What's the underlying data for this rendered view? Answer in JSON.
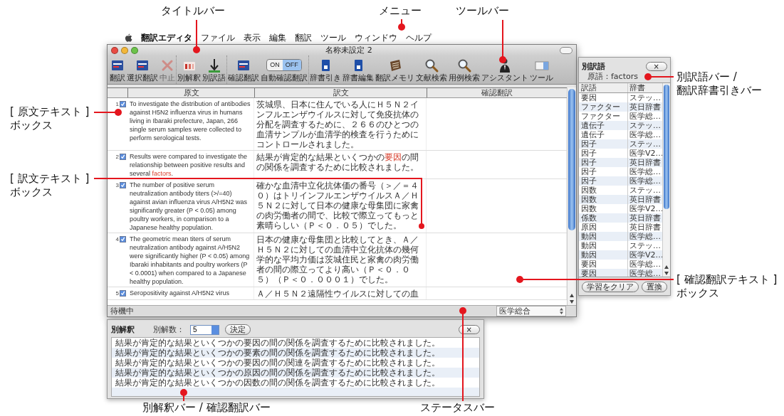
{
  "menu_bar": {
    "items": [
      {
        "kind": "app",
        "label": "翻訳エディタ"
      },
      {
        "kind": "menu",
        "label": "ファイル"
      },
      {
        "kind": "menu",
        "label": "表示"
      },
      {
        "kind": "menu",
        "label": "編集"
      },
      {
        "kind": "menu",
        "label": "翻訳"
      },
      {
        "kind": "menu",
        "label": "ツール"
      },
      {
        "kind": "menu",
        "label": "ウィンドウ"
      },
      {
        "kind": "menu",
        "label": "ヘルプ"
      }
    ]
  },
  "window": {
    "title": "名称未設定 2",
    "toolbar": {
      "groups": [
        [
          {
            "kind": "button",
            "label": "翻訳",
            "disabled": false
          },
          {
            "kind": "button",
            "label": "選択翻訳",
            "disabled": false
          },
          {
            "kind": "button",
            "label": "中止",
            "disabled": true
          }
        ],
        [
          {
            "kind": "button",
            "label": "別解釈",
            "disabled": false
          },
          {
            "kind": "button",
            "label": "別訳語",
            "disabled": false
          }
        ],
        [
          {
            "kind": "button",
            "label": "確認翻訳",
            "disabled": false
          },
          {
            "kind": "toggle",
            "label": "自動確認翻訳",
            "on_text": "ON",
            "off_text": "OFF",
            "on": false
          }
        ],
        [
          {
            "kind": "button",
            "label": "辞書引き",
            "disabled": false
          },
          {
            "kind": "button",
            "label": "辞書編集",
            "disabled": false
          },
          {
            "kind": "button",
            "label": "翻訳メモリ",
            "disabled": false
          },
          {
            "kind": "button",
            "label": "文献検索",
            "disabled": false
          },
          {
            "kind": "button",
            "label": "用例検索",
            "disabled": false
          },
          {
            "kind": "button",
            "label": "アシスタント",
            "disabled": false
          },
          {
            "kind": "button",
            "label": "ツール",
            "disabled": false
          }
        ]
      ]
    },
    "table": {
      "columns": [
        "原文",
        "訳文",
        "確認翻訳"
      ],
      "rows": [
        {
          "number": "1",
          "checked": true,
          "source": [
            "To investigate the distribution of antibodies against H5N2 influenza virus in humans living in Ibaraki prefecture, Japan, 266 single serum samples were collected to perform serological tests."
          ],
          "translation": [
            "茨城県、日本に住んでいる人にＨ５Ｎ２インフルエンザウイルスに対して免疫抗体の分配を調査するために、２６６のひとつの血清サンプルが血清学的検査を行うためにコントロールされました。"
          ]
        },
        {
          "number": "2",
          "checked": true,
          "source": [
            "Results were compared to investigate the relationship between positive results and several ",
            {
              "text": "factors",
              "highlight": true
            },
            "."
          ],
          "translation": [
            "結果が肯定的な結果といくつかの",
            {
              "text": "要因",
              "highlight": true
            },
            "の間の関係を調査するために比較されました。"
          ]
        },
        {
          "number": "3",
          "checked": true,
          "source": [
            "The number of positive serum neutralization antibody titers (>/=40) against avian influenza virus A/H5N2 was significantly greater (P < 0.05) among poultry workers, in comparison to a Japanese healthy population."
          ],
          "translation": [
            "確かな血清中立化抗体価の番号（＞／＝４０）はトリインフルエンザウイルスＡ／Ｈ５Ｎ２に対して日本の健康な母集団に家禽の肉労働者の間で、比較で際立ってもっと素晴らしい（Ｐ＜０．０５）でした。"
          ]
        },
        {
          "number": "4",
          "checked": true,
          "source": [
            "The geometric mean titers of serum neutralization antibody against A/H5N2 were significantly higher (P < 0.05) among Ibaraki inhabitants and poultry workers (P < 0.0001) when compared to a Japanese healthy population."
          ],
          "translation": [
            "日本の健康な母集団と比較してとき、Ａ／Ｈ５Ｎ２に対しての血清中立化抗体の幾何学的な平均力価は茨城住民と家禽の肉労働者の間の際立ってより高い（Ｐ＜０．０５）（Ｐ＜０．０００１）でした。"
          ]
        },
        {
          "number": "5",
          "checked": true,
          "source": [
            "Seropositivity against A/H5N2 virus"
          ],
          "translation": [
            "Ａ／Ｈ５Ｎ２遠隔性ウイルスに対しての血"
          ]
        }
      ]
    },
    "status_bar": {
      "text": "待機中",
      "dictionary": "医学総合"
    }
  },
  "alternatives_panel": {
    "title": "別訳語",
    "close": "×",
    "source_word": "原語：factors",
    "columns": [
      "訳語",
      "辞書"
    ],
    "rows": [
      {
        "term": "要因",
        "dictionary": "ステッ…"
      },
      {
        "term": "ファクター",
        "dictionary": "英日辞書"
      },
      {
        "term": "ファクター",
        "dictionary": "医学総…"
      },
      {
        "term": "遺伝子",
        "dictionary": "ステッ…"
      },
      {
        "term": "遺伝子",
        "dictionary": "医学総…"
      },
      {
        "term": "因子",
        "dictionary": "ステッ…"
      },
      {
        "term": "因子",
        "dictionary": "医学V2…"
      },
      {
        "term": "因子",
        "dictionary": "英日辞書"
      },
      {
        "term": "因子",
        "dictionary": "医学総…"
      },
      {
        "term": "因子",
        "dictionary": "医学総…"
      },
      {
        "term": "因数",
        "dictionary": "ステッ…"
      },
      {
        "term": "因数",
        "dictionary": "英日辞書"
      },
      {
        "term": "因数",
        "dictionary": "医学V2…"
      },
      {
        "term": "係数",
        "dictionary": "英日辞書"
      },
      {
        "term": "原因",
        "dictionary": "英日辞書"
      },
      {
        "term": "動因",
        "dictionary": "医学総…"
      },
      {
        "term": "動因",
        "dictionary": "ステッ…"
      },
      {
        "term": "動因",
        "dictionary": "医学V2…"
      },
      {
        "term": "要因",
        "dictionary": "医学総…"
      },
      {
        "term": "要因",
        "dictionary": "医学総…"
      }
    ],
    "buttons": [
      "学習をクリア",
      "置換"
    ]
  },
  "alternative_interpretations": {
    "title": "別解釈",
    "count_label": "別解数：",
    "count": "5",
    "apply": "決定",
    "close": "×",
    "rows": [
      "結果が肯定的な結果といくつかの要因の間の関係を調査するために比較されました。",
      "結果が肯定的な結果といくつかの要素の間の関係を調査するために比較されました。",
      "結果が肯定的な結果といくつかの要因の間の関連を調査するために比較されました。",
      "結果が肯定的な結果といくつかの原因の間の関係を調査するために比較されました。",
      "結果が肯定的な結果といくつかの因数の間の関係を調査するために比較されました。"
    ]
  },
  "callouts": [
    {
      "lines": [
        "タイトルバー"
      ]
    },
    {
      "lines": [
        "メニュー"
      ]
    },
    {
      "lines": [
        "ツールバー"
      ]
    },
    {
      "lines": [
        "別訳語バー /",
        "翻訳辞書引きバー"
      ]
    },
    {
      "lines": [
        "[ 原文テキスト ]",
        "ボックス"
      ]
    },
    {
      "lines": [
        "[ 訳文テキスト ]",
        "ボックス"
      ]
    },
    {
      "lines": [
        "[ 確認翻訳テキスト ]",
        "ボックス"
      ]
    },
    {
      "lines": [
        "別解釈バー / 確認翻訳バー"
      ]
    },
    {
      "lines": [
        "ステータスバー"
      ]
    }
  ]
}
